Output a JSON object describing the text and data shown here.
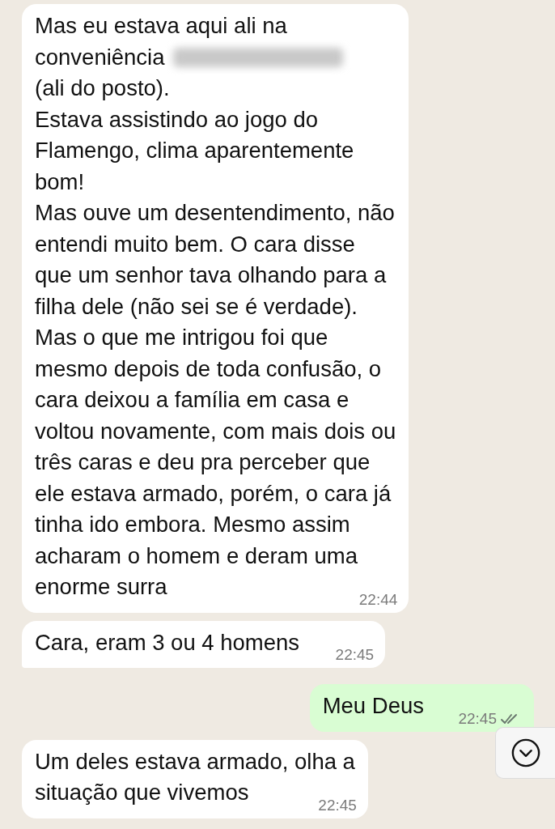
{
  "messages": [
    {
      "outgoing": false,
      "tail": false,
      "time": "22:44",
      "lines": [
        {
          "kind": "text",
          "text": "Mas eu estava aqui ali na"
        },
        {
          "kind": "redacted",
          "text": "conveniência"
        },
        {
          "kind": "text",
          "text": "(ali do posto)."
        },
        {
          "kind": "text",
          "text": "Estava assistindo ao jogo do"
        },
        {
          "kind": "text",
          "text": "Flamengo, clima aparentemente"
        },
        {
          "kind": "text",
          "text": "bom!"
        },
        {
          "kind": "text",
          "text": "Mas ouve um desentendimento, não"
        },
        {
          "kind": "text",
          "text": "entendi muito bem. O cara disse"
        },
        {
          "kind": "text",
          "text": "que um senhor tava olhando para a"
        },
        {
          "kind": "text",
          "text": "filha dele (não sei se é verdade)."
        },
        {
          "kind": "text",
          "text": "Mas o que me intrigou foi que"
        },
        {
          "kind": "text",
          "text": "mesmo depois de toda confusão, o"
        },
        {
          "kind": "text",
          "text": "cara deixou a família em casa e"
        },
        {
          "kind": "text",
          "text": "voltou novamente, com mais dois ou"
        },
        {
          "kind": "text",
          "text": "três caras e deu pra perceber que"
        },
        {
          "kind": "text",
          "text": "ele estava armado, porém, o cara já"
        },
        {
          "kind": "text",
          "text": "tinha ido embora. Mesmo assim"
        },
        {
          "kind": "text",
          "text": "acharam o homem e deram uma"
        },
        {
          "kind": "text",
          "text": "enorme surra"
        }
      ]
    },
    {
      "outgoing": false,
      "tail": true,
      "time": "22:45",
      "lines": [
        {
          "kind": "text",
          "text": "Cara, eram 3 ou 4 homens"
        }
      ]
    },
    {
      "outgoing": true,
      "tail": true,
      "time": "22:45",
      "read": false,
      "lines": [
        {
          "kind": "text",
          "text": "Meu Deus"
        }
      ]
    },
    {
      "outgoing": false,
      "tail": false,
      "time": "22:45",
      "lines": [
        {
          "kind": "text",
          "text": "Um deles estava armado, olha a"
        },
        {
          "kind": "text",
          "text": "situação que vivemos"
        }
      ]
    }
  ]
}
